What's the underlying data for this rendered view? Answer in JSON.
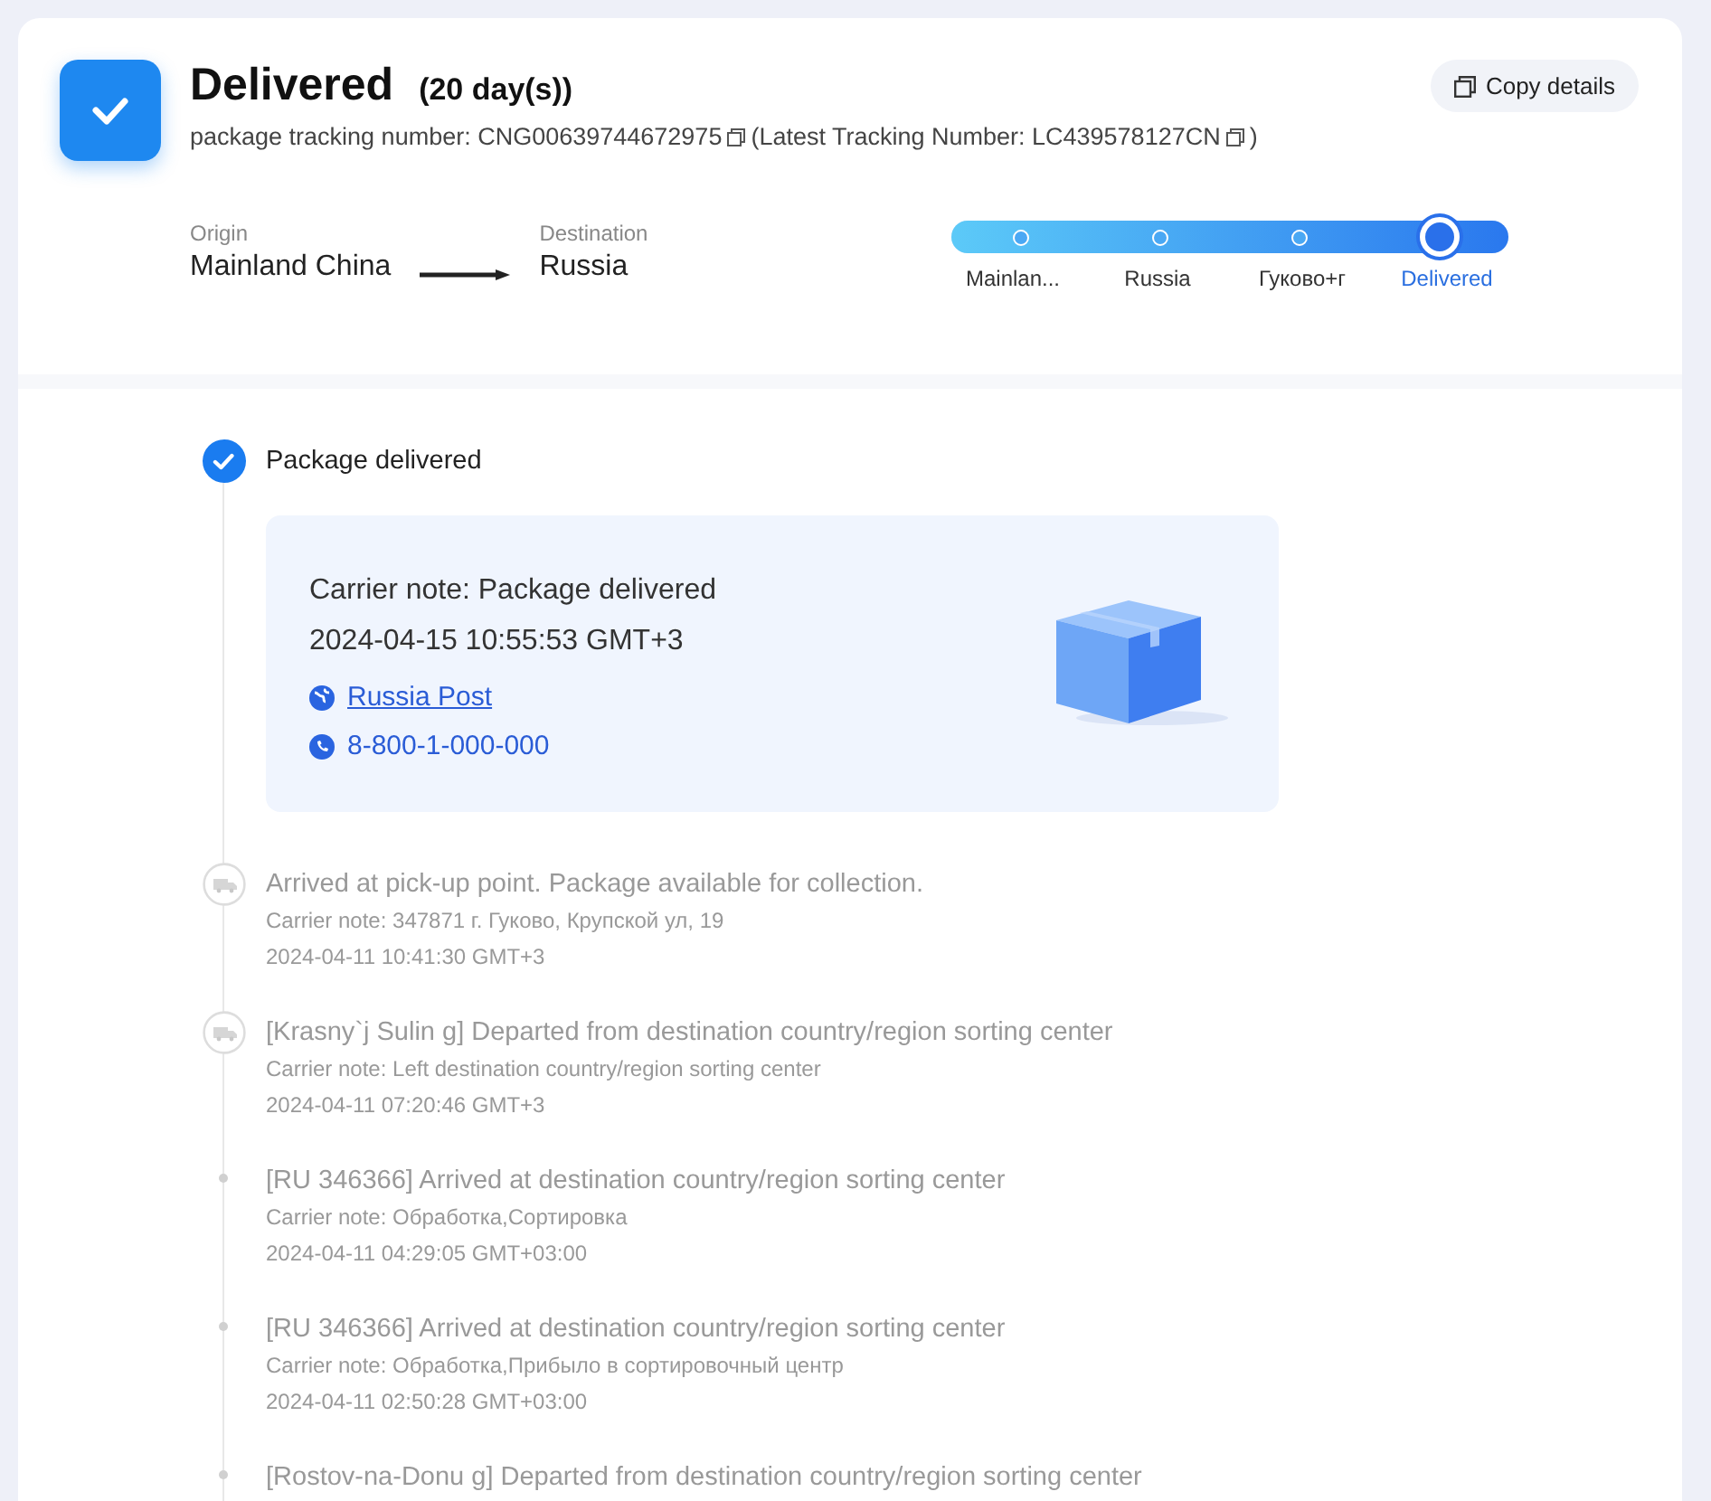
{
  "header": {
    "status": "Delivered",
    "duration": "(20 day(s))",
    "tracking_label": "package tracking number: CNG00639744672975",
    "latest_label": "(Latest Tracking Number: LC439578127CN",
    "latest_close": ")",
    "copy_button": "Copy details"
  },
  "route": {
    "origin_label": "Origin",
    "origin": "Mainland China",
    "destination_label": "Destination",
    "destination": "Russia"
  },
  "progress": {
    "level": 1,
    "stops": [
      {
        "label": "Mainlan...",
        "selected": false
      },
      {
        "label": "Russia",
        "selected": false
      },
      {
        "label": "Гуково+г",
        "selected": false
      },
      {
        "label": "Delivered",
        "selected": true
      }
    ]
  },
  "events": [
    {
      "kind": "current",
      "title": "Package delivered",
      "card": {
        "note": "Carrier note: Package delivered",
        "time": "2024-04-15 10:55:53 GMT+3",
        "carrier": "Russia Post",
        "phone": "8-800-1-000-000"
      }
    },
    {
      "kind": "truck",
      "title": "Arrived at pick-up point. Package available for collection.",
      "note": "Carrier note: 347871 г. Гуково, Крупской ул, 19",
      "time": "2024-04-11 10:41:30 GMT+3"
    },
    {
      "kind": "truck",
      "title": "[Krasny`j Sulin g] Departed from destination country/region sorting center",
      "note": "Carrier note: Left destination country/region sorting center",
      "time": "2024-04-11 07:20:46 GMT+3"
    },
    {
      "kind": "dot",
      "title": "[RU 346366] Arrived at destination country/region sorting center",
      "note": "Carrier note: Обработка,Сортировка",
      "time": "2024-04-11 04:29:05 GMT+03:00"
    },
    {
      "kind": "dot",
      "title": "[RU 346366] Arrived at destination country/region sorting center",
      "note": "Carrier note: Обработка,Прибыло в сортировочный центр",
      "time": "2024-04-11 02:50:28 GMT+03:00"
    },
    {
      "kind": "dot",
      "title": "[Rostov-na-Donu g] Departed from destination country/region sorting center"
    }
  ]
}
